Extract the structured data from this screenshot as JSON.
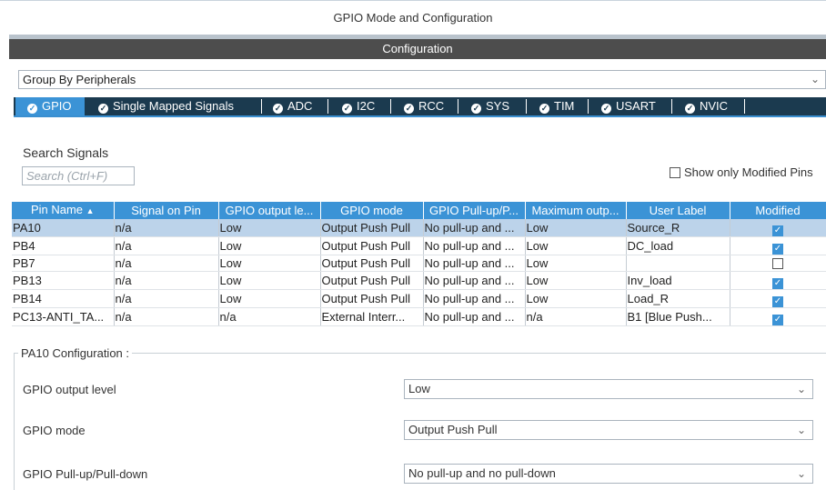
{
  "window": {
    "title": "GPIO Mode and Configuration"
  },
  "config_bar": {
    "label": "Configuration"
  },
  "group_by": {
    "value": "Group By Peripherals"
  },
  "tabs": [
    {
      "label": "GPIO",
      "active": true
    },
    {
      "label": "Single Mapped Signals"
    },
    {
      "label": "ADC"
    },
    {
      "label": "I2C"
    },
    {
      "label": "RCC"
    },
    {
      "label": "SYS"
    },
    {
      "label": "TIM"
    },
    {
      "label": "USART"
    },
    {
      "label": "NVIC"
    }
  ],
  "search": {
    "label": "Search Signals",
    "placeholder": "Search (Ctrl+F)"
  },
  "show_modified": {
    "label": "Show only Modified Pins"
  },
  "table": {
    "headers": [
      "Pin Name",
      "Signal on Pin",
      "GPIO output le...",
      "GPIO mode",
      "GPIO Pull-up/P...",
      "Maximum outp...",
      "User Label",
      "Modified"
    ],
    "sort_icon": "sort-arrow-icon",
    "rows": [
      {
        "pin": "PA10",
        "signal": "n/a",
        "output": "Low",
        "mode": "Output Push Pull",
        "pull": "No pull-up and ...",
        "max": "Low",
        "label": "Source_R",
        "modified": true,
        "selected": true
      },
      {
        "pin": "PB4",
        "signal": "n/a",
        "output": "Low",
        "mode": "Output Push Pull",
        "pull": "No pull-up and ...",
        "max": "Low",
        "label": "DC_load",
        "modified": true
      },
      {
        "pin": "PB7",
        "signal": "n/a",
        "output": "Low",
        "mode": "Output Push Pull",
        "pull": "No pull-up and ...",
        "max": "Low",
        "label": "",
        "modified": false
      },
      {
        "pin": "PB13",
        "signal": "n/a",
        "output": "Low",
        "mode": "Output Push Pull",
        "pull": "No pull-up and ...",
        "max": "Low",
        "label": "Inv_load",
        "modified": true
      },
      {
        "pin": "PB14",
        "signal": "n/a",
        "output": "Low",
        "mode": "Output Push Pull",
        "pull": "No pull-up and ...",
        "max": "Low",
        "label": "Load_R",
        "modified": true
      },
      {
        "pin": "PC13-ANTI_TA...",
        "signal": "n/a",
        "output": "n/a",
        "mode": "External Interr...",
        "pull": "No pull-up and ...",
        "max": "n/a",
        "label": "B1 [Blue Push...",
        "modified": true
      }
    ]
  },
  "pin_config": {
    "title": "PA10 Configuration :",
    "fields": [
      {
        "label": "GPIO output level",
        "value": "Low"
      },
      {
        "label": "GPIO mode",
        "value": "Output Push Pull"
      },
      {
        "label": "GPIO Pull-up/Pull-down",
        "value": "No pull-up and no pull-down"
      }
    ]
  },
  "colors": {
    "accent": "#3b93d6",
    "tab_bar": "#1b3a4f",
    "header_dark": "#4d4d4d",
    "selected_row": "#bcd3ea"
  }
}
